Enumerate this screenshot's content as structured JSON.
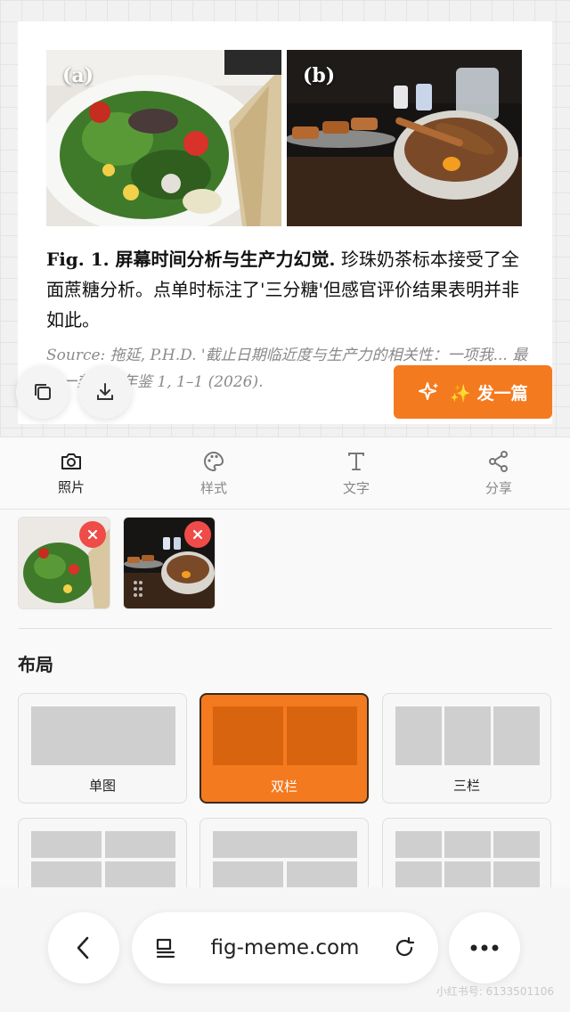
{
  "figure": {
    "panel_a_label": "(a)",
    "panel_b_label": "(b)",
    "caption_bold": "Fig. 1. 屏幕时间分析与生产力幻觉.",
    "caption_text": " 珍珠奶茶标本接受了全面蔗糖分析。点单时标注了'三分糖'但感官评价结果表明并非如此。",
    "source": "Source: 拖延, P.H.D. '截止日期临近度与生产力的相关性：一项我... 最后一刻研究年鉴 1, 1–1 (2026)."
  },
  "actions": {
    "publish_label": "✨ 发一篇",
    "copy_icon": "copy-icon",
    "download_icon": "download-icon"
  },
  "toolbar": {
    "items": [
      {
        "label": "照片",
        "icon": "camera-icon"
      },
      {
        "label": "样式",
        "icon": "palette-icon"
      },
      {
        "label": "文字",
        "icon": "text-icon"
      },
      {
        "label": "分享",
        "icon": "share-icon"
      }
    ],
    "active_index": 0
  },
  "photos": {
    "count": 2,
    "items": [
      {
        "alt": "salad",
        "icon": "remove-icon"
      },
      {
        "alt": "bowl and skewers",
        "icon": "remove-icon"
      }
    ]
  },
  "layout": {
    "title": "布局",
    "options": [
      {
        "label": "单图"
      },
      {
        "label": "双栏"
      },
      {
        "label": "三栏"
      }
    ],
    "selected": "双栏"
  },
  "browser": {
    "url": "fig-meme.com",
    "watermark": "小红书号: 6133501106"
  },
  "colors": {
    "accent": "#f47a1f",
    "remove": "#ef4b48"
  }
}
